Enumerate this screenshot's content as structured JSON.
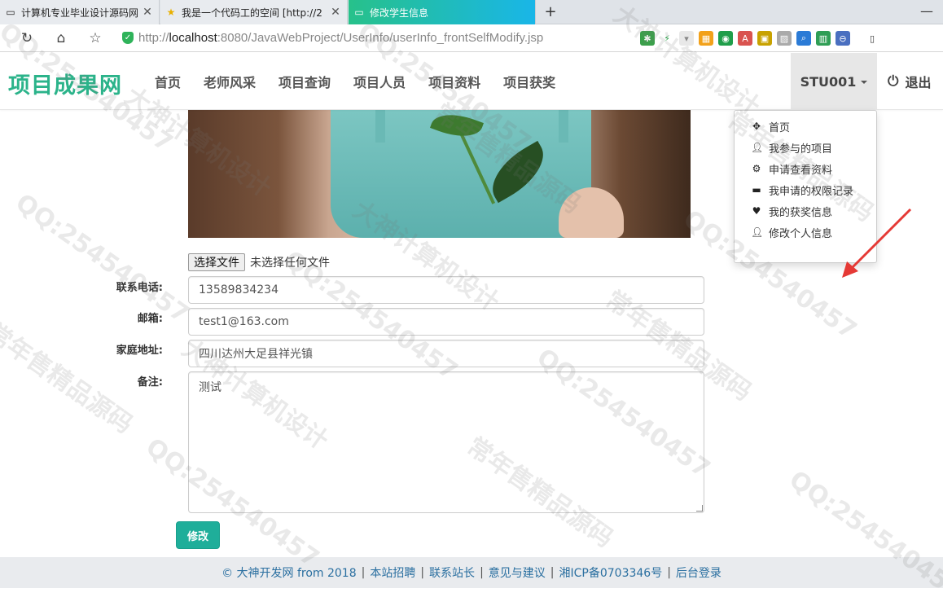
{
  "browser": {
    "tabs": [
      {
        "title": "计算机专业毕业设计源码网",
        "icon": "page-icon",
        "active": false
      },
      {
        "title": "我是一个代码工的空间 [http://2",
        "icon": "star-icon",
        "active": false
      },
      {
        "title": "修改学生信息",
        "icon": "page-icon",
        "active": true
      }
    ],
    "url_prefix": "http://",
    "url_host": "localhost",
    "url_rest": ":8080/JavaWebProject/UserInfo/userInfo_frontSelfModify.jsp"
  },
  "navbar": {
    "brand": "项目成果网",
    "items": [
      "首页",
      "老师风采",
      "项目查询",
      "项目人员",
      "项目资料",
      "项目获奖"
    ],
    "user": "STU001",
    "logout": "退出"
  },
  "dropdown": {
    "items": [
      {
        "label": "首页",
        "icon": "move-icon"
      },
      {
        "label": "我参与的项目",
        "icon": "user-icon"
      },
      {
        "label": "申请查看资料",
        "icon": "gear-icon"
      },
      {
        "label": "我申请的权限记录",
        "icon": "card-icon"
      },
      {
        "label": "我的获奖信息",
        "icon": "heart-icon"
      },
      {
        "label": "修改个人信息",
        "icon": "user-icon"
      }
    ]
  },
  "form": {
    "file_button": "选择文件",
    "file_status": "未选择任何文件",
    "phone_label": "联系电话:",
    "phone_value": "13589834234",
    "email_label": "邮箱:",
    "email_value": "test1@163.com",
    "address_label": "家庭地址:",
    "address_value": "四川达州大足县祥光镇",
    "memo_label": "备注:",
    "memo_value": "测试",
    "submit": "修改"
  },
  "footer": {
    "copyright": "© 大神开发网 from 2018",
    "links": [
      "本站招聘",
      "联系站长",
      "意见与建议",
      "湘ICP备0703346号",
      "后台登录"
    ]
  },
  "watermark": {
    "texts": [
      "QQ:254540457",
      "大神计算机设计",
      "常年售精品源码"
    ]
  },
  "colors": {
    "brand": "#2bb38a",
    "submit": "#1fae9a",
    "active_tab_start": "#27c18a",
    "active_tab_end": "#19b6e8",
    "arrow": "#e53935"
  }
}
